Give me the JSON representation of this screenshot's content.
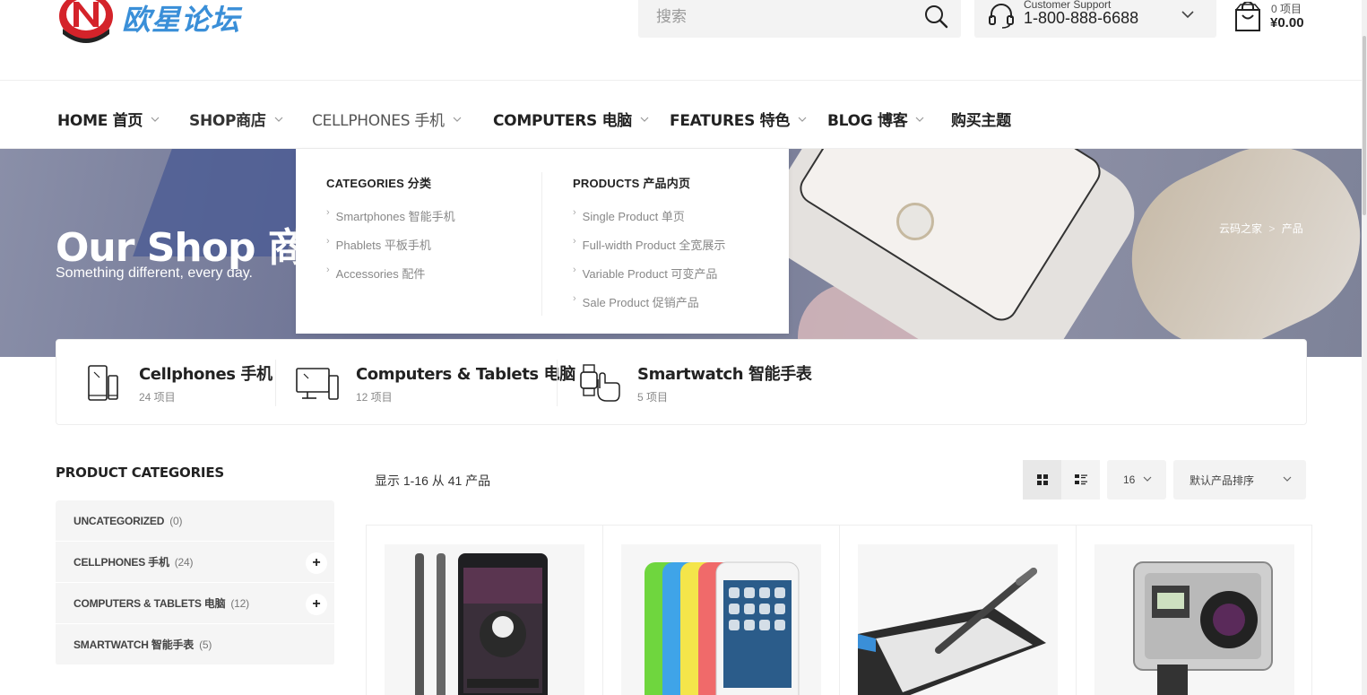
{
  "header": {
    "logo_text": "欧星论坛",
    "search_placeholder": "搜索",
    "support_label": "Customer Support",
    "support_phone": "1-800-888-6688",
    "cart_count": "0 项目",
    "cart_total": "¥0.00"
  },
  "nav": {
    "items": [
      {
        "label": "HOME 首页"
      },
      {
        "label": "SHOP商店"
      },
      {
        "label": "CELLPHONES 手机"
      },
      {
        "label": "COMPUTERS 电脑"
      },
      {
        "label": "FEATURES 特色"
      },
      {
        "label": "BLOG 博客"
      },
      {
        "label": "购买主题"
      }
    ]
  },
  "mega_menu": {
    "categories_title": "CATEGORIES 分类",
    "categories": [
      "Smartphones 智能手机",
      "Phablets 平板手机",
      "Accessories 配件"
    ],
    "products_title": "PRODUCTS 产品内页",
    "products": [
      "Single Product 单页",
      "Full-width Product 全宽展示",
      "Variable Product 可变产品",
      "Sale Product 促销产品"
    ]
  },
  "hero": {
    "title": "Our Shop 商",
    "subtitle": "Something different, every day.",
    "breadcrumb_home": "云码之家",
    "breadcrumb_sep": ">",
    "breadcrumb_current": "产品"
  },
  "category_strip": [
    {
      "name": "Cellphones 手机",
      "count": "24 项目",
      "icon": "cellphone-icon"
    },
    {
      "name": "Computers & Tablets 电脑",
      "count": "12 项目",
      "icon": "computer-icon"
    },
    {
      "name": "Smartwatch 智能手表",
      "count": "5 项目",
      "icon": "smartwatch-icon"
    }
  ],
  "sidebar": {
    "title": "PRODUCT CATEGORIES",
    "items": [
      {
        "label": "UNCATEGORIZED",
        "count": "(0)"
      },
      {
        "label": "CELLPHONES 手机",
        "count": "(24)",
        "expand": "+"
      },
      {
        "label": "COMPUTERS & TABLETS 电脑",
        "count": "(12)",
        "expand": "+"
      },
      {
        "label": "SMARTWATCH 智能手表",
        "count": "(5)"
      }
    ]
  },
  "toolbar": {
    "results_text": "显示 1-16 从 41 产品",
    "per_page": "16",
    "sort": "默认产品排序"
  },
  "products": [
    {
      "image": "sony-xperia-phone"
    },
    {
      "image": "iphone-5c-colors"
    },
    {
      "image": "drawing-tablet-pen"
    },
    {
      "image": "gopro-hero4"
    }
  ],
  "colors": {
    "accent_logo": "#3a8fd8",
    "logo_red": "#d4232a",
    "text_dark": "#222222",
    "panel_bg": "#f3f3f3"
  }
}
